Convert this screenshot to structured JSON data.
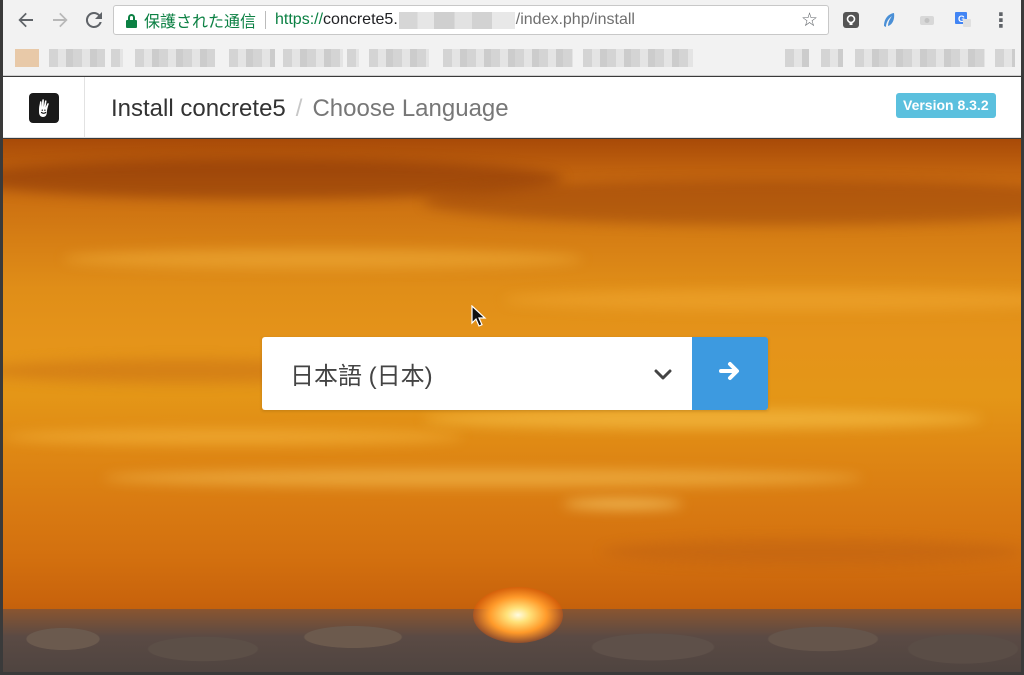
{
  "browser": {
    "secure_label": "保護された通信",
    "url_scheme": "https://",
    "url_host": "concrete5.",
    "url_path": "/index.php/install"
  },
  "header": {
    "title": "Install concrete5",
    "separator": "/",
    "step": "Choose Language",
    "version": "Version 8.3.2"
  },
  "language_picker": {
    "selected": "日本語 (日本)"
  },
  "icons": {
    "back": "back-arrow-icon",
    "forward": "forward-arrow-icon",
    "reload": "reload-icon",
    "lock": "lock-icon",
    "star": "bookmark-star-icon",
    "menu": "more-vert-icon",
    "logo": "concrete5-hand-logo",
    "chevron": "chevron-down-icon",
    "submit": "arrow-right-icon"
  },
  "colors": {
    "secure_green": "#0b8043",
    "badge": "#5bc0de",
    "submit_button": "#3d9ae0"
  }
}
